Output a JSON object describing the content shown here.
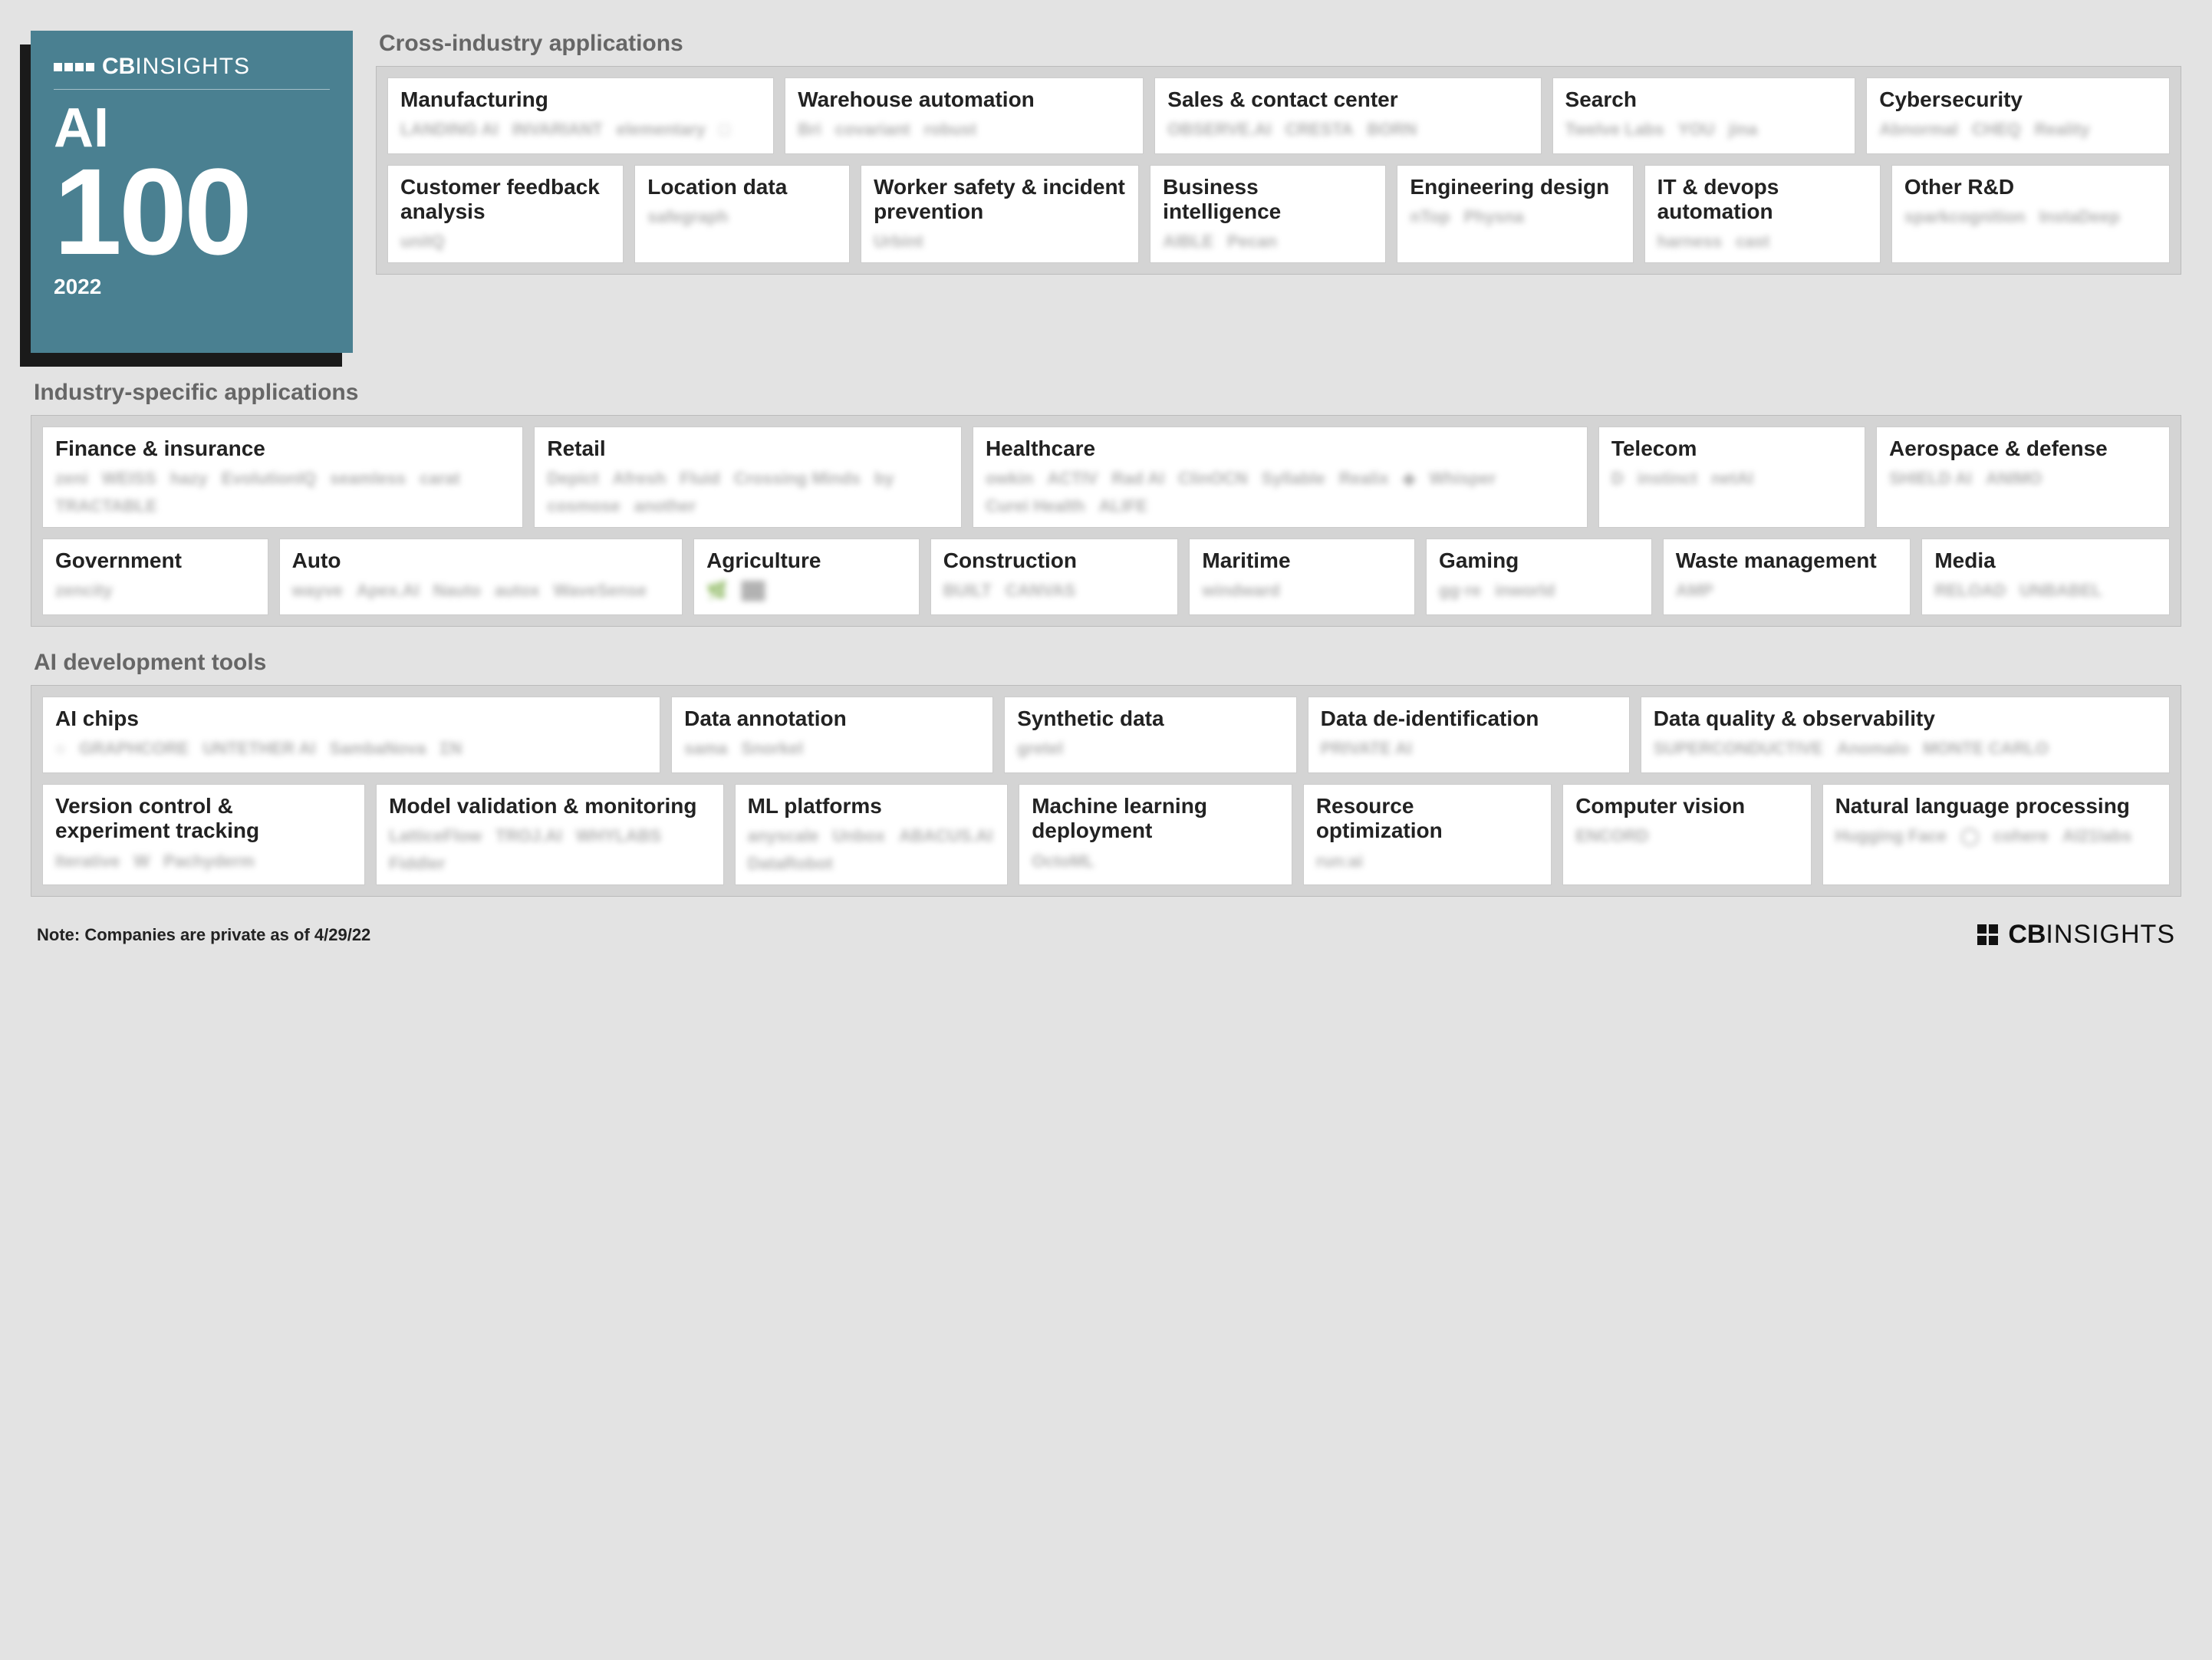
{
  "badge": {
    "brand_prefix": "CB",
    "brand_suffix": "INSIGHTS",
    "title": "AI",
    "number": "100",
    "year": "2022"
  },
  "sections": {
    "cross": {
      "title": "Cross-industry applications",
      "row1": [
        {
          "title": "Manufacturing",
          "logos": [
            "LANDING AI",
            "INVARIANT",
            "elementary",
            "□"
          ]
        },
        {
          "title": "Warehouse automation",
          "logos": [
            "Bri",
            "covariant",
            "robust"
          ]
        },
        {
          "title": "Sales & contact center",
          "logos": [
            "OBSERVE.AI",
            "CRESTA",
            "BORN"
          ]
        },
        {
          "title": "Search",
          "logos": [
            "Twelve Labs",
            "YOU",
            "jina"
          ]
        },
        {
          "title": "Cybersecurity",
          "logos": [
            "Abnormal",
            "CHEQ",
            "Reality"
          ]
        }
      ],
      "row2": [
        {
          "title": "Customer feedback analysis",
          "logos": [
            "unitQ"
          ]
        },
        {
          "title": "Location data",
          "logos": [
            "safegraph"
          ]
        },
        {
          "title": "Worker safety & incident prevention",
          "logos": [
            "Urbint"
          ]
        },
        {
          "title": "Business intelligence",
          "logos": [
            "AIBLE",
            "Pecan"
          ]
        },
        {
          "title": "Engineering design",
          "logos": [
            "nTop",
            "Physna"
          ]
        },
        {
          "title": "IT & devops automation",
          "logos": [
            "harness",
            "cast"
          ]
        },
        {
          "title": "Other R&D",
          "logos": [
            "sparkcognition",
            "InstaDeep"
          ]
        }
      ]
    },
    "industry": {
      "title": "Industry-specific applications",
      "row1": [
        {
          "title": "Finance & insurance",
          "logos": [
            "zeni",
            "WEISS",
            "hazy",
            "EvolutionIQ",
            "seamless",
            "carat",
            "TRACTABLE"
          ]
        },
        {
          "title": "Retail",
          "logos": [
            "Depict",
            "Afresh",
            "Fluid",
            "Crossing Minds",
            "by",
            "cosmose",
            "another"
          ]
        },
        {
          "title": "Healthcare",
          "logos": [
            "owkin",
            "ACTIV",
            "Rad AI",
            "ClinOCN",
            "Syllable",
            "Realix",
            "◆",
            "Whisper",
            "Curei Health",
            "ALIFE"
          ]
        },
        {
          "title": "Telecom",
          "logos": [
            "D",
            "instinct",
            "netAI"
          ]
        },
        {
          "title": "Aerospace & defense",
          "logos": [
            "SHIELD AI",
            "ANIMO"
          ]
        }
      ],
      "row2": [
        {
          "title": "Government",
          "logos": [
            "zencity"
          ]
        },
        {
          "title": "Auto",
          "logos": [
            "wayve",
            "Apex.AI",
            "Nauto",
            "autox",
            "WaveSense"
          ]
        },
        {
          "title": "Agriculture",
          "logos": [
            "🌿",
            "██"
          ]
        },
        {
          "title": "Construction",
          "logos": [
            "BUILT",
            "CANVAS"
          ]
        },
        {
          "title": "Maritime",
          "logos": [
            "windward"
          ]
        },
        {
          "title": "Gaming",
          "logos": [
            "gg·re",
            "inworld"
          ]
        },
        {
          "title": "Waste management",
          "logos": [
            "AMP"
          ]
        },
        {
          "title": "Media",
          "logos": [
            "RELOAD",
            "UNBABEL"
          ]
        }
      ]
    },
    "tools": {
      "title": "AI development tools",
      "row1": [
        {
          "title": "AI chips",
          "logos": [
            "○",
            "GRAPHCORE",
            "UNTETHER AI",
            "SambaNova",
            "ΣN"
          ]
        },
        {
          "title": "Data annotation",
          "logos": [
            "sama",
            "Snorkel"
          ]
        },
        {
          "title": "Synthetic data",
          "logos": [
            "gretel"
          ]
        },
        {
          "title": "Data de-identification",
          "logos": [
            "PRIVATE AI"
          ]
        },
        {
          "title": "Data quality & observability",
          "logos": [
            "SUPERCONDUCTIVE",
            "Anomalo",
            "MONTE CARLO"
          ]
        }
      ],
      "row2": [
        {
          "title": "Version control & experiment tracking",
          "logos": [
            "Iterative",
            "W",
            "Pachyderm"
          ]
        },
        {
          "title": "Model validation & monitoring",
          "logos": [
            "LatticeFlow",
            "TROJ.AI",
            "WHYLABS",
            "Fiddler"
          ]
        },
        {
          "title": "ML platforms",
          "logos": [
            "anyscale",
            "Unbox",
            "ABACUS.AI",
            "DataRobot"
          ]
        },
        {
          "title": "Machine learning deployment",
          "logos": [
            "OctoML"
          ]
        },
        {
          "title": "Resource optimization",
          "logos": [
            "run:ai"
          ]
        },
        {
          "title": "Computer vision",
          "logos": [
            "ENCORD"
          ]
        },
        {
          "title": "Natural language processing",
          "logos": [
            "Hugging Face",
            "◯",
            "cohere",
            "AI21labs"
          ]
        }
      ]
    }
  },
  "footer": {
    "note": "Note: Companies are private as of 4/29/22",
    "brand_prefix": "CB",
    "brand_suffix": "INSIGHTS"
  }
}
